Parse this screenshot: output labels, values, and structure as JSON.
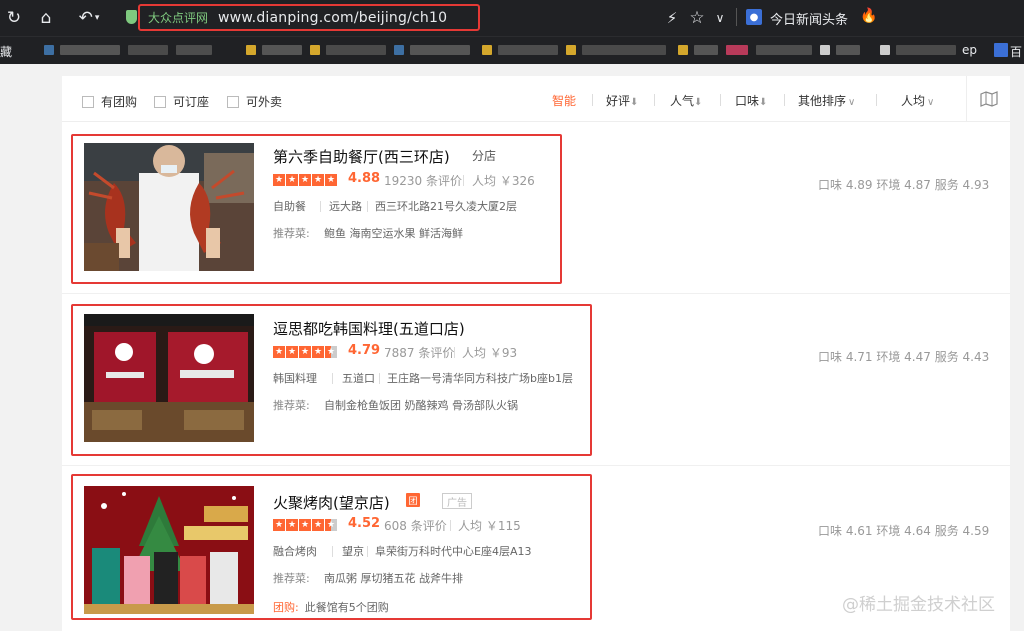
{
  "browser": {
    "site_name": "大众点评网",
    "url": "www.dianping.com/beijing/ch10",
    "news_label": "今日新闻头条",
    "bookmark_left": "藏",
    "bookmark_right_a": "ep",
    "bookmark_right_b": "百"
  },
  "filters": {
    "checkboxes": [
      "有团购",
      "可订座",
      "可外卖"
    ],
    "sorts": [
      "智能",
      "好评",
      "人气",
      "口味",
      "其他排序",
      "人均"
    ]
  },
  "restaurants": [
    {
      "name": "第六季自助餐厅(西三环店)",
      "branch_tag": "分店",
      "score": "4.88",
      "reviews": "19230 条评价",
      "avg_price": "人均 ￥326",
      "category": "自助餐",
      "district": "远大路",
      "address": "西三环北路21号久凌大厦2层",
      "reco_label": "推荐菜:",
      "reco_dishes": "鲍鱼  海南空运水果  鲜活海鲜",
      "ratings": "口味 4.89   环境 4.87   服务 4.93"
    },
    {
      "name": "逗思都吃韩国料理(五道口店)",
      "score": "4.79",
      "reviews": "7887 条评价",
      "avg_price": "人均 ￥93",
      "category": "韩国料理",
      "district": "五道口",
      "address": "王庄路一号清华同方科技广场b座b1层",
      "reco_label": "推荐菜:",
      "reco_dishes": "自制金枪鱼饭团  奶酪辣鸡  骨汤部队火锅",
      "ratings": "口味 4.71   环境 4.47   服务 4.43"
    },
    {
      "name": "火聚烤肉(望京店)",
      "tuan_badge": "团",
      "ad_tag": "广告",
      "score": "4.52",
      "reviews": "608 条评价",
      "avg_price": "人均 ￥115",
      "category": "融合烤肉",
      "district": "望京",
      "address": "阜荣街万科时代中心E座4层A13",
      "reco_label": "推荐菜:",
      "reco_dishes": "南瓜粥  厚切猪五花  战斧牛排",
      "group_label": "团购:",
      "group_text": "此餐馆有5个团购",
      "ratings": "口味 4.61   环境 4.64   服务 4.59"
    }
  ],
  "watermark": "@稀土掘金技术社区",
  "colors": {
    "accent": "#ff6633",
    "highlight": "#e53935",
    "chrome": "#202124"
  }
}
